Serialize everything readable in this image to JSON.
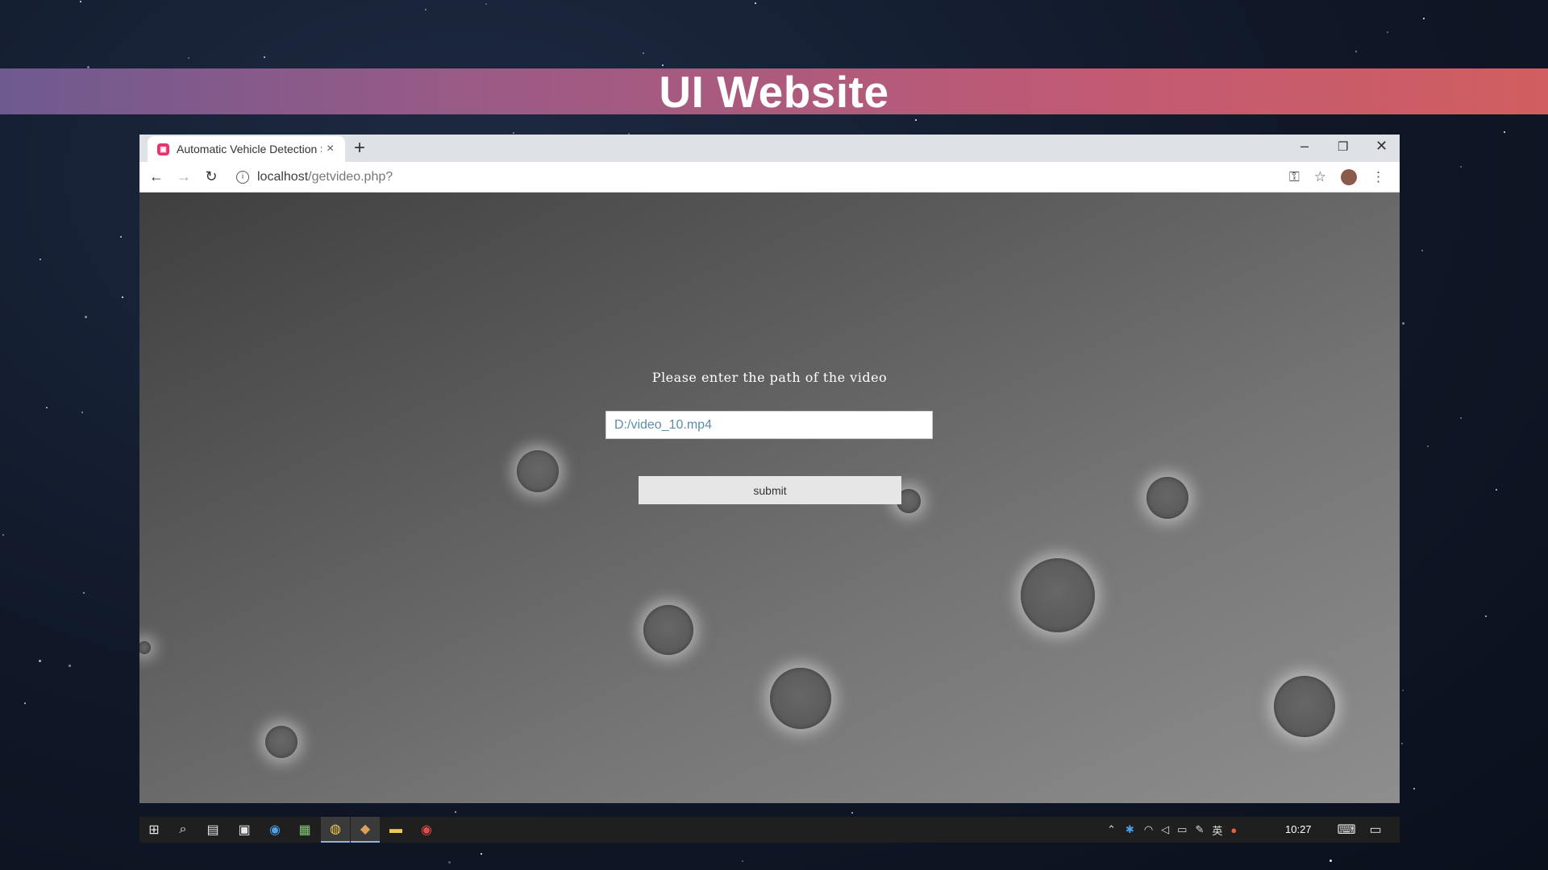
{
  "banner": {
    "title": "UI Website"
  },
  "browser": {
    "tab": {
      "favicon": "app-favicon-icon",
      "title": "Automatic Vehicle Detection S",
      "close": "×"
    },
    "new_tab": "+",
    "window_controls": {
      "minimize": "–",
      "maximize": "❐",
      "close": "✕"
    },
    "nav": {
      "back": "←",
      "forward": "→",
      "reload": "↻"
    },
    "address": {
      "host": "localhost",
      "path": "/getvideo.php?"
    },
    "toolbar_icons": {
      "key": "⚿",
      "star": "☆",
      "menu": "⋮"
    }
  },
  "page": {
    "prompt": "Please enter the path of the video",
    "input_value": "D:/video_10.mp4",
    "submit_label": "submit"
  },
  "taskbar": {
    "items": [
      "windows-start-icon",
      "search-icon",
      "task-view-icon",
      "store-icon",
      "edge-icon",
      "app-icon",
      "chrome-icon",
      "app-icon",
      "file-explorer-icon",
      "recorder-icon"
    ],
    "tray": {
      "ime": "英",
      "clock": "10:27"
    }
  },
  "colors": {
    "accent_left": "#6e5a8f",
    "accent_right": "#d15e60",
    "favicon": "#e8336d"
  }
}
